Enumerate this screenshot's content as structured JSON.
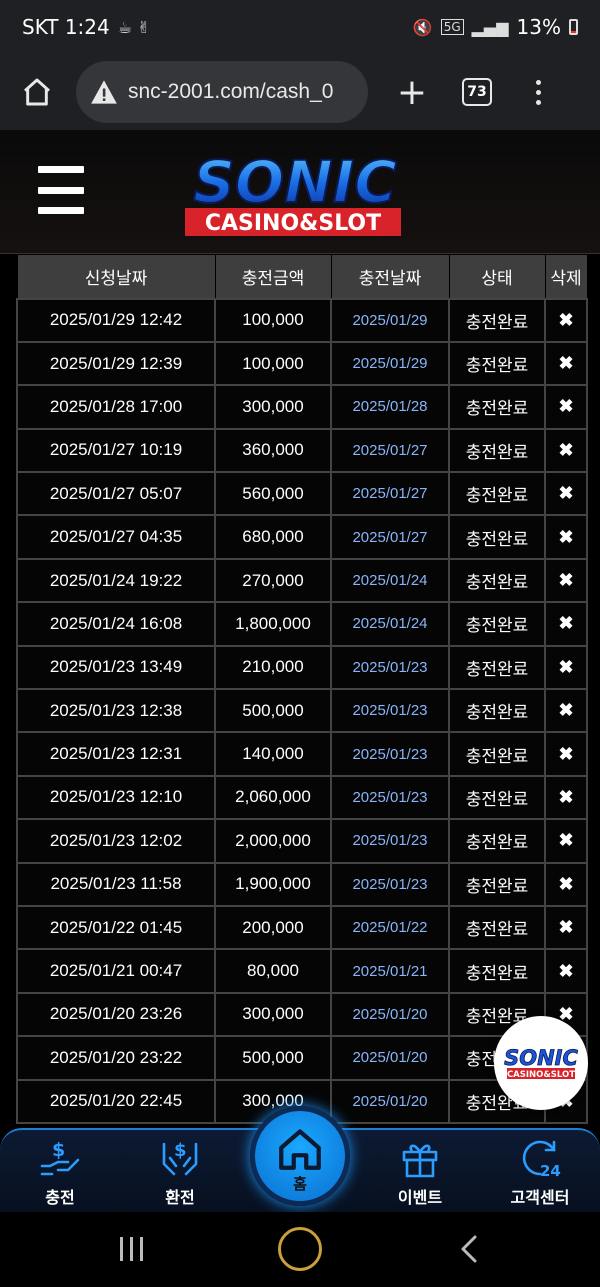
{
  "status_bar": {
    "carrier_time": "SKT 1:24",
    "network": "5G",
    "battery": "13%"
  },
  "browser": {
    "url": "snc-2001.com/cash_0",
    "tab_count": "73"
  },
  "site": {
    "logo_main": "SONIC",
    "logo_sub": "CASINO&SLOT"
  },
  "table": {
    "headers": [
      "신청날짜",
      "충전금액",
      "충전날짜",
      "상태",
      "삭제"
    ],
    "rows": [
      [
        "2025/01/29 12:42",
        "100,000",
        "2025/01/29",
        "충전완료",
        "✖"
      ],
      [
        "2025/01/29 12:39",
        "100,000",
        "2025/01/29",
        "충전완료",
        "✖"
      ],
      [
        "2025/01/28 17:00",
        "300,000",
        "2025/01/28",
        "충전완료",
        "✖"
      ],
      [
        "2025/01/27 10:19",
        "360,000",
        "2025/01/27",
        "충전완료",
        "✖"
      ],
      [
        "2025/01/27 05:07",
        "560,000",
        "2025/01/27",
        "충전완료",
        "✖"
      ],
      [
        "2025/01/27 04:35",
        "680,000",
        "2025/01/27",
        "충전완료",
        "✖"
      ],
      [
        "2025/01/24 19:22",
        "270,000",
        "2025/01/24",
        "충전완료",
        "✖"
      ],
      [
        "2025/01/24 16:08",
        "1,800,000",
        "2025/01/24",
        "충전완료",
        "✖"
      ],
      [
        "2025/01/23 13:49",
        "210,000",
        "2025/01/23",
        "충전완료",
        "✖"
      ],
      [
        "2025/01/23 12:38",
        "500,000",
        "2025/01/23",
        "충전완료",
        "✖"
      ],
      [
        "2025/01/23 12:31",
        "140,000",
        "2025/01/23",
        "충전완료",
        "✖"
      ],
      [
        "2025/01/23 12:10",
        "2,060,000",
        "2025/01/23",
        "충전완료",
        "✖"
      ],
      [
        "2025/01/23 12:02",
        "2,000,000",
        "2025/01/23",
        "충전완료",
        "✖"
      ],
      [
        "2025/01/23 11:58",
        "1,900,000",
        "2025/01/23",
        "충전완료",
        "✖"
      ],
      [
        "2025/01/22 01:45",
        "200,000",
        "2025/01/22",
        "충전완료",
        "✖"
      ],
      [
        "2025/01/21 00:47",
        "80,000",
        "2025/01/21",
        "충전완료",
        "✖"
      ],
      [
        "2025/01/20 23:26",
        "300,000",
        "2025/01/20",
        "충전완료",
        "✖"
      ],
      [
        "2025/01/20 23:22",
        "500,000",
        "2025/01/20",
        "충전완료",
        "✖"
      ],
      [
        "2025/01/20 22:45",
        "300,000",
        "2025/01/20",
        "충전완료",
        "✖"
      ]
    ]
  },
  "bottom_nav": {
    "charge": "충전",
    "exchange": "환전",
    "home": "홈",
    "event": "이벤트",
    "support": "고객센터",
    "support_badge": "24"
  },
  "colors": {
    "accent_blue": "#1c8ff0",
    "date_link": "#8ab4f8",
    "logo_red": "#d8232a"
  },
  "icons": [
    "home-icon",
    "warning-icon",
    "plus-icon",
    "tabs-icon",
    "overflow-menu-icon",
    "hamburger-icon",
    "dollar-hand-icon",
    "exchange-hand-icon",
    "gift-icon",
    "support-24-icon"
  ]
}
